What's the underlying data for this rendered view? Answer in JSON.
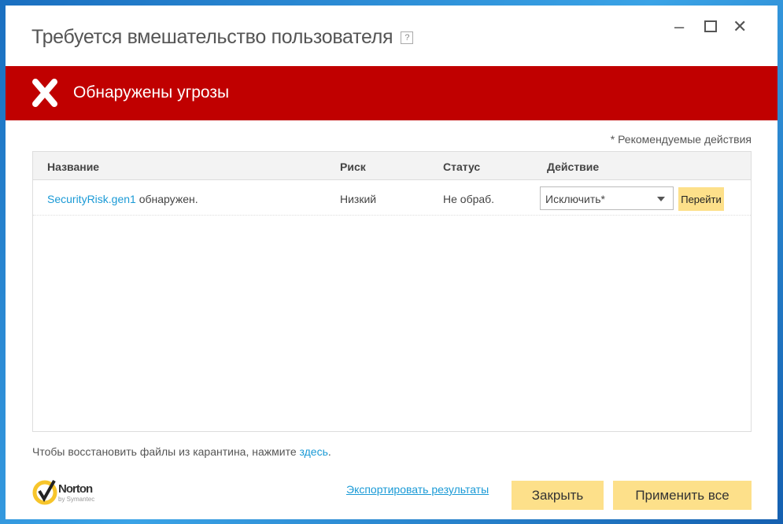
{
  "window": {
    "title": "Требуется вмешательство пользователя",
    "help": "?",
    "minimize": "–",
    "maximize": "☐",
    "close": "✕"
  },
  "banner": {
    "message": "Обнаружены угрозы",
    "color": "#c00000"
  },
  "note": "* Рекомендуемые действия",
  "table": {
    "headers": [
      "Название",
      "Риск",
      "Статус",
      "Действие"
    ],
    "rows": [
      {
        "name_link": "SecurityRisk.gen1",
        "name_suffix": "обнаружен.",
        "risk": "Низкий",
        "status": "Не обраб.",
        "action": "Исключить*",
        "go": "Перейти"
      }
    ]
  },
  "footer": {
    "restore_text": "Чтобы восстановить файлы из карантина, нажмите",
    "restore_link": "здесь",
    "restore_end": ".",
    "logo_name": "Norton",
    "logo_sub": "by Symantec",
    "export": "Экспортировать результаты",
    "close": "Закрыть",
    "apply_all": "Применить все"
  }
}
